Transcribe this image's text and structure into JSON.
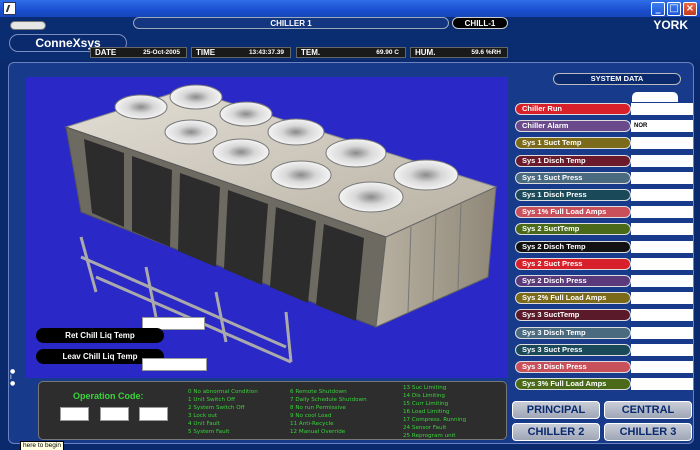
{
  "window": {
    "minimize": "_",
    "maximize": "□",
    "close": "×"
  },
  "header": {
    "brand": "YORK",
    "chiller_title": "CHILLER 1",
    "chiller_tag": "CHILL-1",
    "logo": "ConneXsys",
    "date_label": "DATE",
    "date_value": "25-Oct-2005",
    "time_label": "TIME",
    "time_value": "13:43:37.39",
    "temp_label": "TEM.",
    "temp_value": "69.90 C",
    "hum_label": "HUM.",
    "hum_value": "59.6 %RH"
  },
  "system_data": {
    "title": "SYSTEM DATA",
    "items": [
      {
        "label": "Chiller Run",
        "color": "#d8202a",
        "value": ""
      },
      {
        "label": "Chiller Alarm",
        "color": "#6a4a8a",
        "value": "NOR"
      },
      {
        "label": "Sys 1 Suct Temp",
        "color": "#7a6a1a",
        "value": ""
      },
      {
        "label": "Sys 1 Disch Temp",
        "color": "#6a1a2a",
        "value": ""
      },
      {
        "label": "Sys 1 Suct Press",
        "color": "#4a6a80",
        "value": ""
      },
      {
        "label": "Sys 1 Disch Press",
        "color": "#1a4a5a",
        "value": ""
      },
      {
        "label": "Sys 1% Full Load Amps",
        "color": "#c8505a",
        "value": ""
      },
      {
        "label": "Sys 2 SuctTemp",
        "color": "#4a6a1a",
        "value": ""
      },
      {
        "label": "Sys 2 Disch Temp",
        "color": "#111111",
        "value": ""
      },
      {
        "label": "Sys 2 Suct Press",
        "color": "#d8202a",
        "value": ""
      },
      {
        "label": "Sys 2 Disch Press",
        "color": "#5a3a7a",
        "value": ""
      },
      {
        "label": "Sys 2% Full Load Amps",
        "color": "#7a6a1a",
        "value": ""
      },
      {
        "label": "Sys 3 SuctTemp",
        "color": "#5a1a2a",
        "value": ""
      },
      {
        "label": "Sys 3 Disch Temp",
        "color": "#4a6a80",
        "value": ""
      },
      {
        "label": "Sys 3 Suct Press",
        "color": "#1a4a5a",
        "value": ""
      },
      {
        "label": "Sys 3 Disch Press",
        "color": "#c8505a",
        "value": ""
      },
      {
        "label": "Sys 3% Full Load Amps",
        "color": "#4a6a1a",
        "value": ""
      }
    ]
  },
  "temps": {
    "ret_label": "Ret Chill Liq Temp",
    "ret_value": "",
    "leav_label": "Leav Chill Liq Temp",
    "leav_value": ""
  },
  "operation": {
    "title": "Operation Code:",
    "codes_col1": [
      "0 No abnormal Condition",
      "1 Unit Switch Off",
      "2 System Switch Off",
      "3 Lock out",
      "4 Unit Fault",
      "5 System Fault"
    ],
    "codes_col2": [
      "6 Remote Shutdown",
      "7 Daily Schedule Shutdown",
      "8 No run Permissive",
      "9 No cool Load",
      "11 Anti-Recycle",
      "12 Manual Override"
    ],
    "codes_col3": [
      "13 Suc Limiting",
      "14 Dis Limiting",
      "15 Curr Limiting",
      "16 Load Limiting",
      "17 Compress. Running",
      "24 Sensor Fault",
      "25 Reprogram unit"
    ]
  },
  "nav": {
    "principal": "PRINCIPAL",
    "central": "CENTRAL",
    "chiller2": "CHILLER 2",
    "chiller3": "CHILLER 3"
  },
  "tooltip": "here to begin"
}
